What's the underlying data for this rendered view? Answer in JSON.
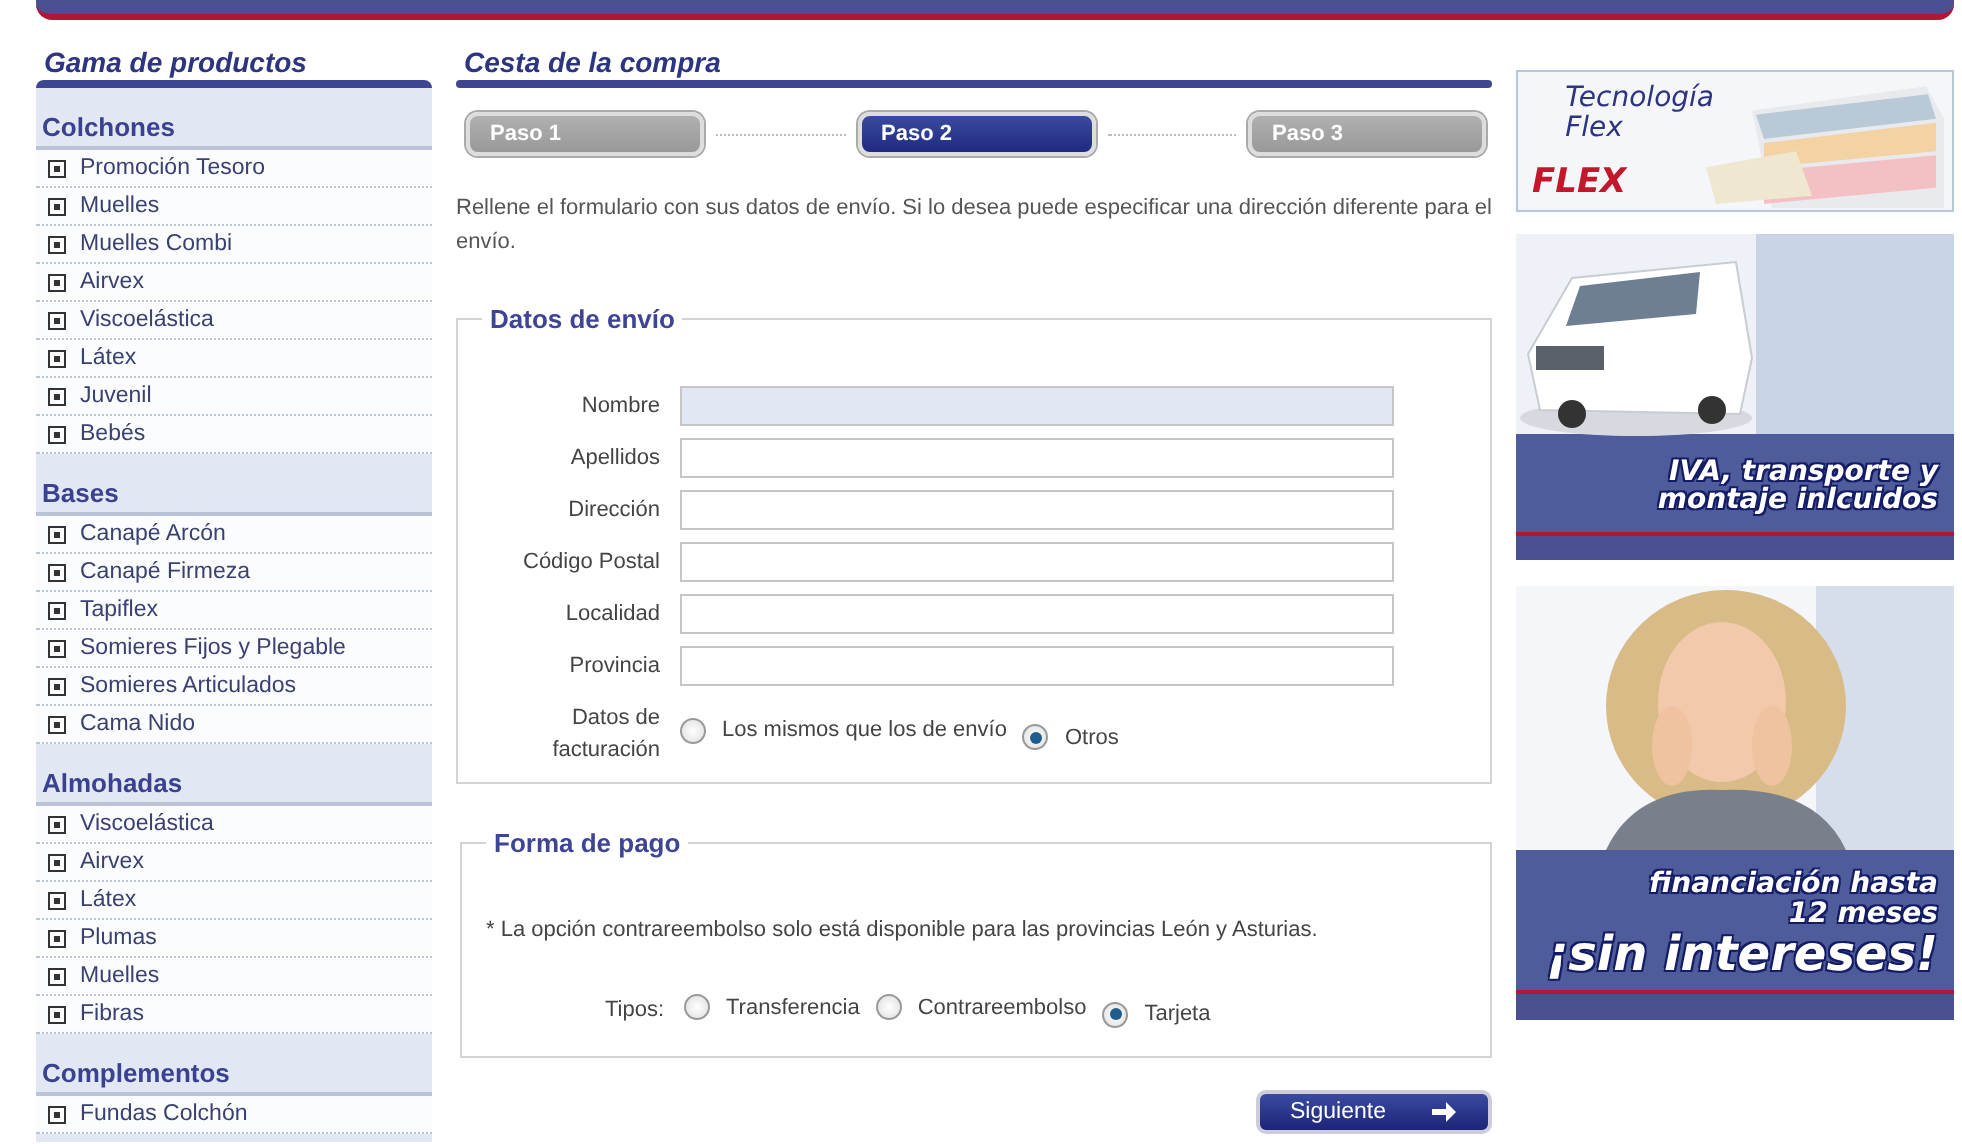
{
  "sidebar": {
    "title": "Gama de productos",
    "sections": [
      {
        "title": "Colchones",
        "items": [
          "Promoción Tesoro",
          "Muelles",
          "Muelles Combi",
          "Airvex",
          "Viscoelástica",
          "Látex",
          "Juvenil",
          "Bebés"
        ]
      },
      {
        "title": "Bases",
        "items": [
          "Canapé Arcón",
          "Canapé Firmeza",
          "Tapiflex",
          "Somieres Fijos y Plegable",
          "Somieres Articulados",
          "Cama Nido"
        ]
      },
      {
        "title": "Almohadas",
        "items": [
          "Viscoelástica",
          "Airvex",
          "Látex",
          "Plumas",
          "Muelles",
          "Fibras"
        ]
      },
      {
        "title": "Complementos",
        "items": [
          "Fundas Colchón"
        ]
      }
    ]
  },
  "main": {
    "title": "Cesta de la compra",
    "steps": [
      {
        "label": "Paso 1",
        "selected": false
      },
      {
        "label": "Paso 2",
        "selected": true
      },
      {
        "label": "Paso 3",
        "selected": false
      }
    ],
    "intro": "Rellene el formulario con sus datos de envío. Si lo desea puede especificar una dirección diferente para el envío.",
    "shipping": {
      "legend": "Datos de envío",
      "fields": [
        {
          "label": "Nombre",
          "focused": true
        },
        {
          "label": "Apellidos",
          "focused": false
        },
        {
          "label": "Dirección",
          "focused": false
        },
        {
          "label": "Código Postal",
          "focused": false
        },
        {
          "label": "Localidad",
          "focused": false
        },
        {
          "label": "Provincia",
          "focused": false
        }
      ],
      "billing": {
        "label": "Datos de facturación",
        "options": [
          {
            "label": "Los mismos que los de envío",
            "selected": false
          },
          {
            "label": "Otros",
            "selected": true
          }
        ]
      }
    },
    "payment": {
      "legend": "Forma de pago",
      "note": "* La opción contrareembolso solo está disponible para las provincias León y Asturias.",
      "types_label": "Tipos:",
      "options": [
        {
          "label": "Transferencia",
          "selected": false
        },
        {
          "label": "Contrareembolso",
          "selected": false
        },
        {
          "label": "Tarjeta",
          "selected": true
        }
      ]
    },
    "next_button": "Siguiente"
  },
  "banners": [
    {
      "kind": "flex",
      "lines": [
        "Tecnología",
        "Flex"
      ],
      "logo": "FLEX"
    },
    {
      "kind": "van",
      "lines": [
        "IVA, transporte y",
        "montaje inlcuidos"
      ]
    },
    {
      "kind": "promo",
      "lines": [
        "financiación hasta",
        "12 meses",
        "¡sin intereses!"
      ]
    }
  ]
}
